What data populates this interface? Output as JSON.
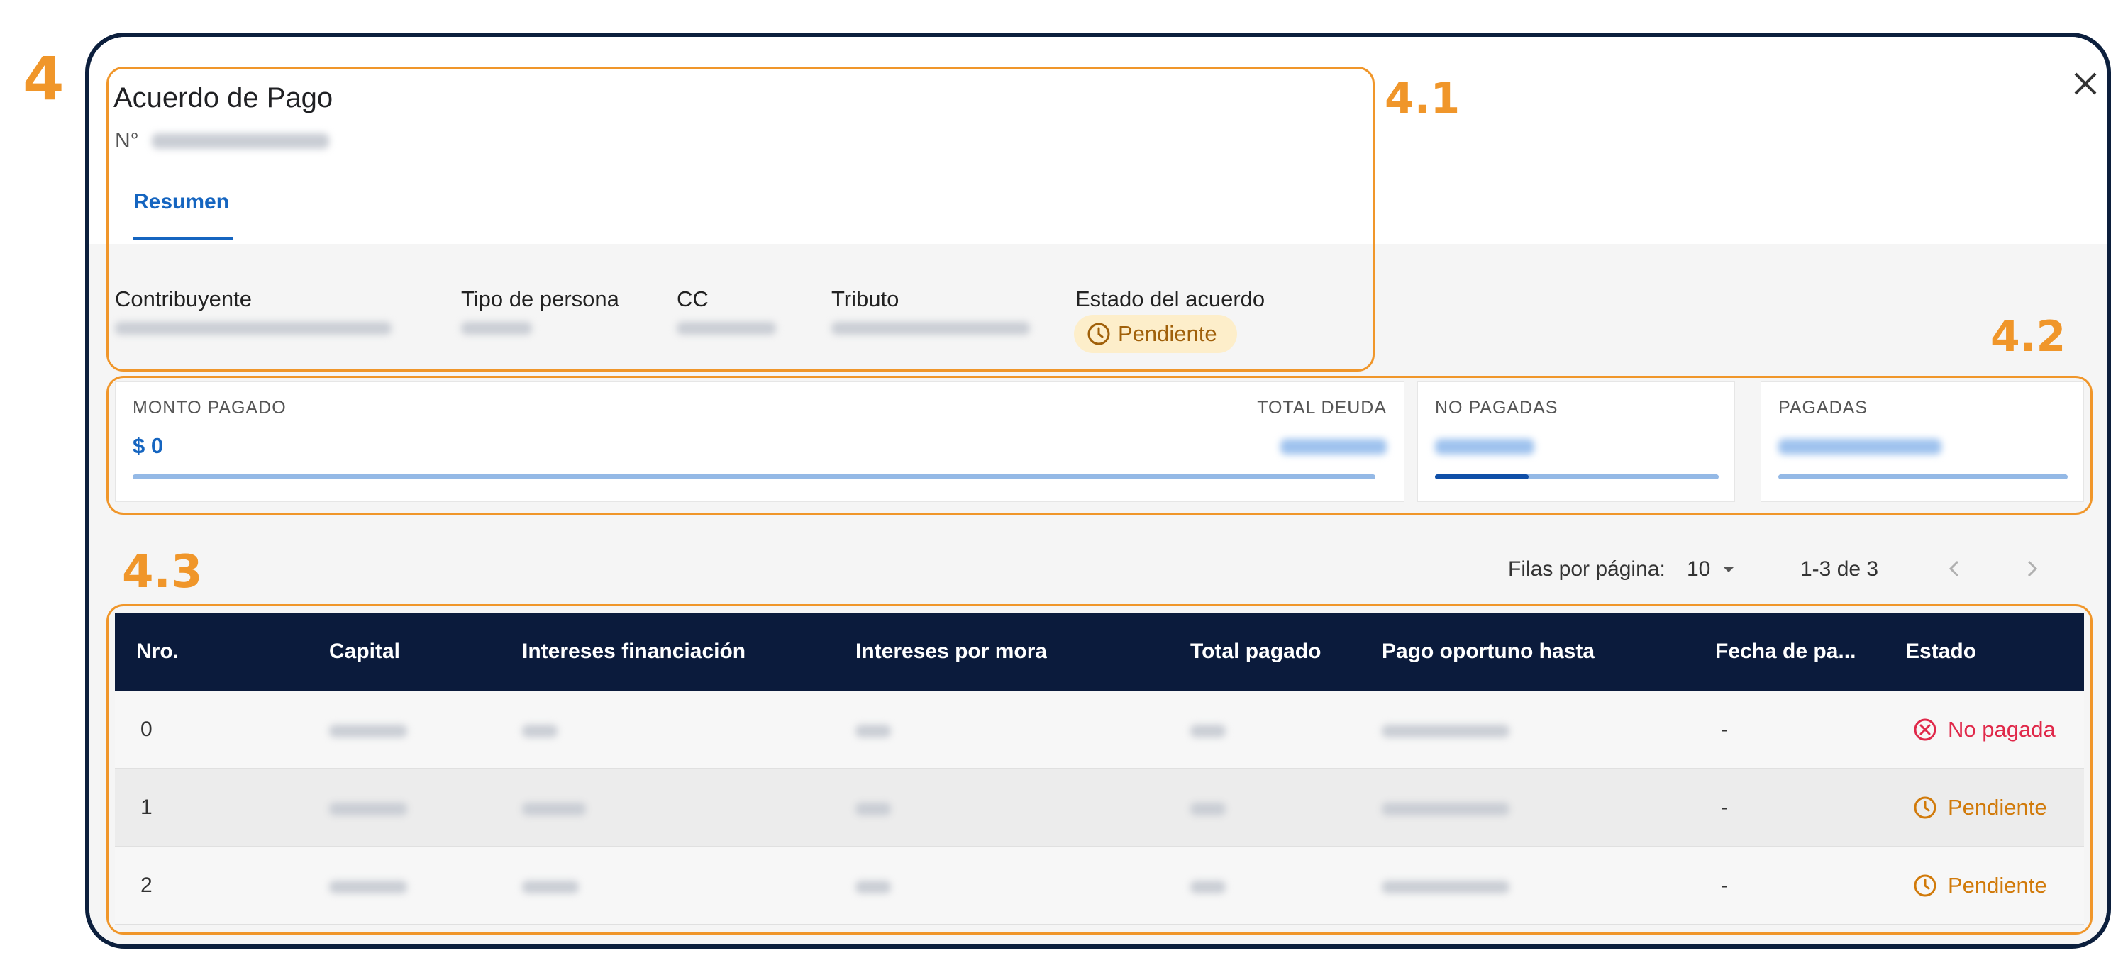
{
  "annotations": {
    "main": "4",
    "header": "4.1",
    "summary": "4.2",
    "table": "4.3"
  },
  "dialog": {
    "title": "Acuerdo de Pago",
    "number_prefix": "N°",
    "tabs": [
      {
        "label": "Resumen",
        "active": true
      }
    ]
  },
  "info": {
    "contribuyente_label": "Contribuyente",
    "tipo_persona_label": "Tipo de persona",
    "cc_label": "CC",
    "tributo_label": "Tributo",
    "estado_label": "Estado del acuerdo",
    "estado_value": "Pendiente"
  },
  "summary": {
    "monto_pagado_label": "MONTO PAGADO",
    "monto_pagado_value": "$ 0",
    "monto_pagado_progress": 0,
    "total_deuda_label": "TOTAL DEUDA",
    "no_pagadas_label": "NO PAGADAS",
    "no_pagadas_progress": 0.33,
    "pagadas_label": "PAGADAS",
    "pagadas_progress": 0
  },
  "pagination": {
    "rows_label": "Filas por página:",
    "rows_value": "10",
    "range": "1-3 de 3"
  },
  "table": {
    "columns": [
      "Nro.",
      "Capital",
      "Intereses financiación",
      "Intereses por mora",
      "Total pagado",
      "Pago oportuno hasta",
      "Fecha de pa...",
      "Estado"
    ],
    "rows": [
      {
        "nro": "0",
        "fecha_pago": "-",
        "estado": "No pagada"
      },
      {
        "nro": "1",
        "fecha_pago": "-",
        "estado": "Pendiente"
      },
      {
        "nro": "2",
        "fecha_pago": "-",
        "estado": "Pendiente"
      }
    ]
  },
  "colors": {
    "annotation": "#f0962a",
    "header_bg": "#0b1b3c",
    "accent": "#1565c0",
    "status_pending": "#d17a0a",
    "status_unpaid": "#e0294a",
    "chip_bg": "#fdeeca"
  },
  "icons": [
    "close-icon",
    "clock-icon",
    "cancel-circle-icon",
    "caret-down-icon",
    "chevron-left-icon",
    "chevron-right-icon"
  ]
}
